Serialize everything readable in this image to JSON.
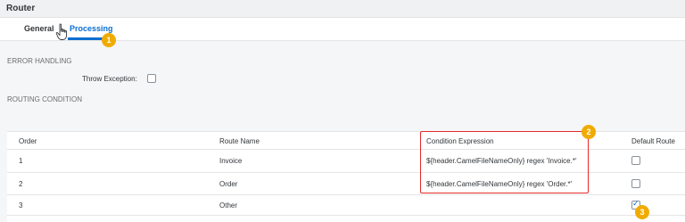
{
  "window": {
    "title": "Router"
  },
  "tabs": [
    {
      "label": "General"
    },
    {
      "label": "Processing"
    }
  ],
  "sections": {
    "error_handling": {
      "heading": "ERROR HANDLING",
      "throw_exception_label": "Throw Exception:",
      "throw_exception_checked": false
    },
    "routing_condition": {
      "heading": "ROUTING CONDITION"
    }
  },
  "table": {
    "columns": [
      "Order",
      "Route Name",
      "Condition Expression",
      "Default Route"
    ],
    "rows": [
      {
        "order": "1",
        "route_name": "Invoice",
        "condition": "${header.CamelFileNameOnly} regex 'Invoice.*'",
        "default_route": false
      },
      {
        "order": "2",
        "route_name": "Order",
        "condition": "${header.CamelFileNameOnly} regex 'Order.*'",
        "default_route": false
      },
      {
        "order": "3",
        "route_name": "Other",
        "condition": "",
        "default_route": true
      }
    ]
  },
  "callouts": [
    "1",
    "2",
    "3"
  ],
  "colors": {
    "accent": "#0a6ed1",
    "badge": "#f0ab00",
    "highlight_border": "#e52929"
  },
  "icons": [
    "hand-cursor-icon",
    "checkbox-icon"
  ]
}
